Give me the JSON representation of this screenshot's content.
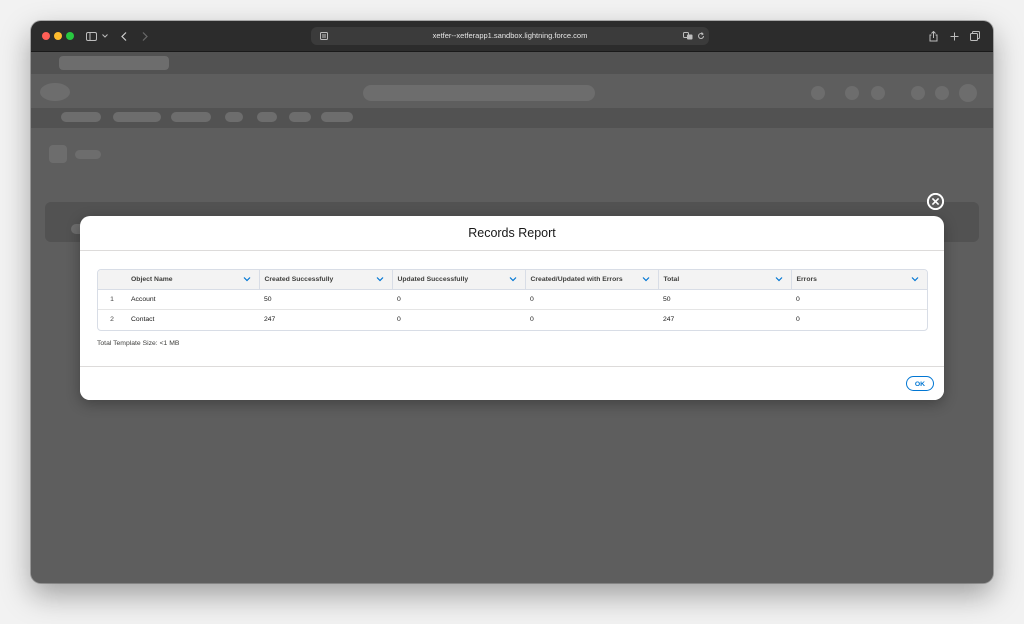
{
  "browser": {
    "url": "xetfer--xetferapp1.sandbox.lightning.force.com",
    "icons": [
      "sidebar-icon",
      "chevron-down-icon",
      "back-icon",
      "forward-icon",
      "site-settings-icon",
      "translate-icon",
      "reload-icon",
      "share-icon",
      "new-tab-icon",
      "tabs-overview-icon"
    ]
  },
  "modal": {
    "title": "Records Report",
    "columns": [
      "Object Name",
      "Created Successfully",
      "Updated Successfully",
      "Created/Updated with Errors",
      "Total",
      "Errors"
    ],
    "rows": [
      {
        "num": "1",
        "cells": [
          "Account",
          "50",
          "0",
          "0",
          "50",
          "0"
        ]
      },
      {
        "num": "2",
        "cells": [
          "Contact",
          "247",
          "0",
          "0",
          "247",
          "0"
        ]
      }
    ],
    "template_size": "Total Template Size:  <1 MB",
    "ok_label": "OK"
  },
  "colors": {
    "accent": "#0176d3",
    "overlay": "#5e5e5e"
  }
}
